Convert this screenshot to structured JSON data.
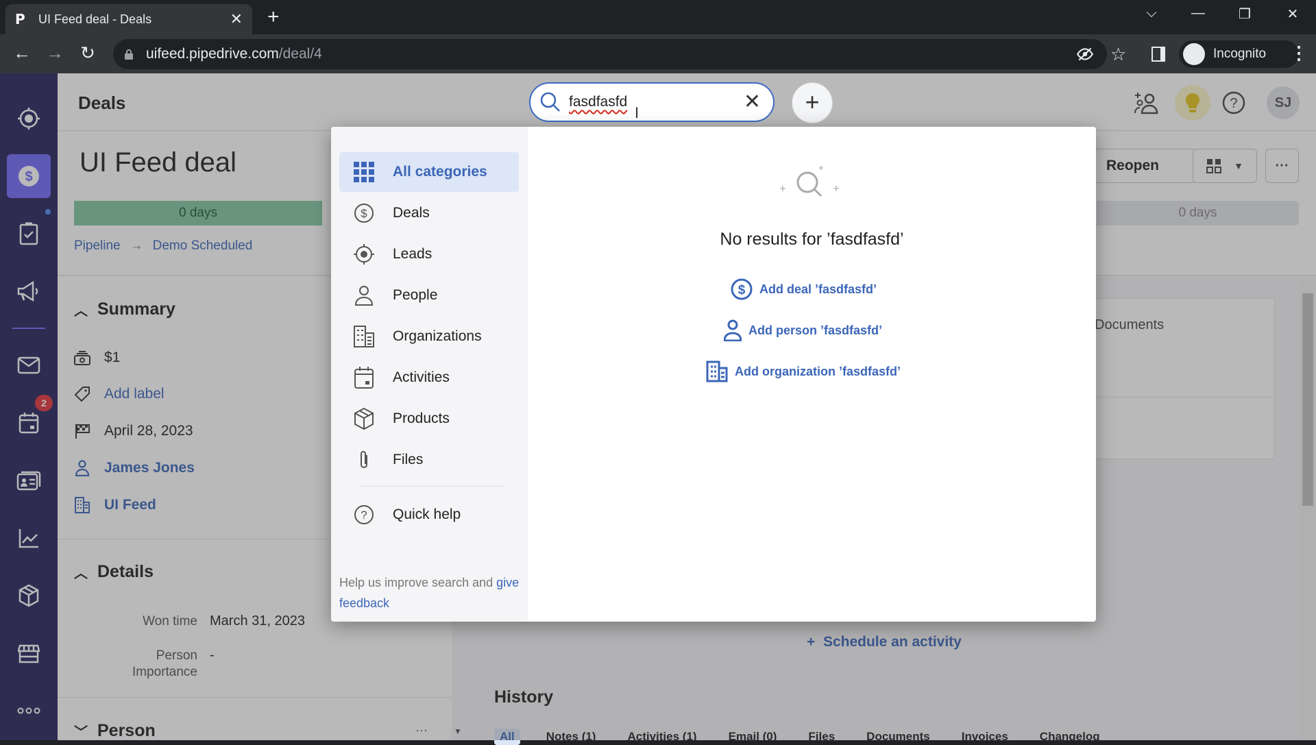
{
  "browser": {
    "tab_title": "UI Feed deal - Deals",
    "tab_favicon": "P",
    "url_host": "uifeed.pipedrive.com",
    "url_path": "/deal/4",
    "profile_label": "Incognito"
  },
  "app": {
    "page_title": "Deals",
    "nav_items": [
      {
        "name": "leads-inbox",
        "icon": "target-icon"
      },
      {
        "name": "deals",
        "icon": "dollar-icon",
        "active": true
      },
      {
        "name": "projects",
        "icon": "clipboard-check-icon"
      },
      {
        "name": "campaigns",
        "icon": "megaphone-icon"
      },
      {
        "name": "mail",
        "icon": "mail-icon"
      },
      {
        "name": "activities",
        "icon": "calendar-icon",
        "badge": "2"
      },
      {
        "name": "contacts",
        "icon": "contact-card-icon"
      },
      {
        "name": "insights",
        "icon": "trend-chart-icon"
      },
      {
        "name": "products",
        "icon": "box-icon"
      },
      {
        "name": "marketplace",
        "icon": "store-icon"
      },
      {
        "name": "more",
        "icon": "more-dots-icon"
      }
    ],
    "user_initials": "SJ",
    "accent_color": "#3b66b8",
    "nav_bg_color": "#26235c",
    "nav_active_color": "#6f6af8"
  },
  "search": {
    "query": "fasdfasfd",
    "categories": [
      {
        "label": "All categories",
        "icon": "grid-icon",
        "active": true
      },
      {
        "label": "Deals",
        "icon": "dollar-circle-icon"
      },
      {
        "label": "Leads",
        "icon": "target-icon"
      },
      {
        "label": "People",
        "icon": "person-icon"
      },
      {
        "label": "Organizations",
        "icon": "building-icon"
      },
      {
        "label": "Activities",
        "icon": "calendar-icon"
      },
      {
        "label": "Products",
        "icon": "box-icon"
      },
      {
        "label": "Files",
        "icon": "paperclip-icon"
      }
    ],
    "quick_help": "Quick help",
    "feedback_text": "Help us improve search and ",
    "feedback_link": "give feedback",
    "no_results": "No results for ’fasdfasfd’",
    "actions": [
      {
        "label": "Add deal ’fasdfasfd’",
        "icon": "dollar-circle-icon"
      },
      {
        "label": "Add person ’fasdfasfd’",
        "icon": "person-icon"
      },
      {
        "label": "Add organization ’fasdfasfd’",
        "icon": "building-icon"
      }
    ]
  },
  "deal": {
    "title": "UI Feed deal",
    "stage_days_left": "0 days",
    "stage_days_right": "0 days",
    "breadcrumb": [
      "Pipeline",
      "Demo Scheduled"
    ],
    "reopen_label": "Reopen",
    "summary": {
      "heading": "Summary",
      "value": "$1",
      "add_label": "Add label",
      "close_date": "April 28, 2023",
      "person": "James Jones",
      "organization": "UI Feed"
    },
    "details": {
      "heading": "Details",
      "fields": [
        {
          "label": "Won time",
          "value": "March 31, 2023"
        },
        {
          "label": "Person Importance",
          "value": "-"
        }
      ]
    },
    "person_heading": "Person",
    "documents_label": "Documents",
    "schedule_activity": "Schedule an activity",
    "history": {
      "heading": "History",
      "tabs": [
        "All",
        "Notes (1)",
        "Activities (1)",
        "Email (0)",
        "Files",
        "Documents",
        "Invoices",
        "Changelog"
      ]
    }
  }
}
